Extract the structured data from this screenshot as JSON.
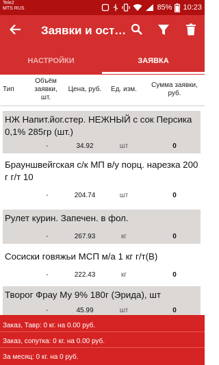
{
  "status_bar": {
    "carrier_line1": "Tele2",
    "carrier_line2": "MTS RUS",
    "battery": "85%",
    "time": "10:23"
  },
  "app_bar": {
    "title": "Заявки и ост…",
    "icons": [
      "arrow-back-icon",
      "search-icon",
      "filter-icon",
      "trash-icon"
    ]
  },
  "tabs": [
    {
      "label": "НАСТРОЙКИ",
      "active": false
    },
    {
      "label": "ЗАЯВКА",
      "active": true
    }
  ],
  "columns": {
    "type": "Тип",
    "volume_line1": "Объём",
    "volume_line2": "заявки,",
    "volume_line3": "шт.",
    "price": "Цена, руб.",
    "unit": "Ед. изм.",
    "sum_line1": "Сумма заявки,",
    "sum_line2": "руб."
  },
  "items": [
    {
      "name": "НЖ Напит.йог.стер. НЕЖНЫЙ с сок Персика 0,1% 285гр (шт.)",
      "volume": "-",
      "price": "34.92",
      "unit": "шт",
      "sum": "0"
    },
    {
      "name": "Брауншвейгская с/к МП в/у порц. нарезка 200 г г/т 10",
      "volume": "-",
      "price": "204.74",
      "unit": "шт",
      "sum": "0"
    },
    {
      "name": "Рулет курин. Запечен. в фол.",
      "volume": "-",
      "price": "267.93",
      "unit": "кг",
      "sum": "0"
    },
    {
      "name": "Сосиски говяжьи МСП м/а 1 кг г/т(В)",
      "volume": "-",
      "price": "222.43",
      "unit": "кг",
      "sum": "0"
    },
    {
      "name": "Творог Фрау Му 9% 180г (Эрида), шт",
      "volume": "-",
      "price": "45.99",
      "unit": "шт",
      "sum": "0"
    }
  ],
  "footer": {
    "line1": "Заказ, Тавр: 0 кг. на 0.00 руб.",
    "line2": "Заказ, сопутка: 0 кг. на 0.00 руб.",
    "line3": "За месяц: 0 кг. на 0 руб."
  },
  "colors": {
    "primary": "#d32f2f",
    "status_bar": "#b01010",
    "row_alt": "#dcd8d6"
  }
}
